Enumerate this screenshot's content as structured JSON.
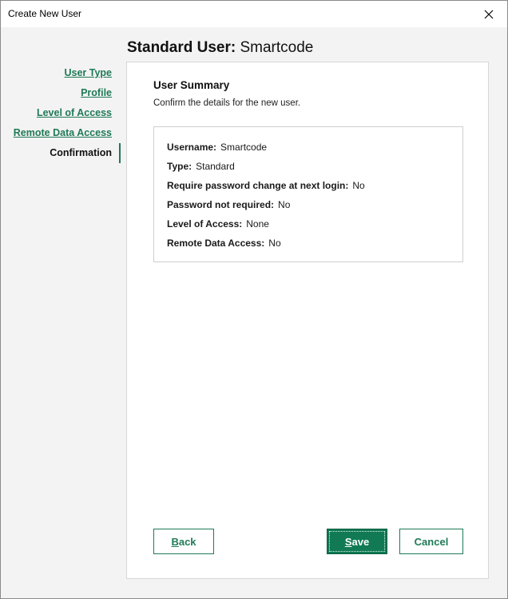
{
  "window": {
    "title": "Create New User"
  },
  "header": {
    "bold": "Standard User:",
    "name": "Smartcode"
  },
  "nav": {
    "items": [
      {
        "label": "User Type"
      },
      {
        "label": "Profile"
      },
      {
        "label": "Level of Access"
      },
      {
        "label": "Remote Data Access"
      },
      {
        "label": "Confirmation"
      }
    ]
  },
  "summary": {
    "heading": "User Summary",
    "description": "Confirm the details for the new user.",
    "rows": [
      {
        "key": "Username:",
        "value": "Smartcode"
      },
      {
        "key": "Type:",
        "value": "Standard"
      },
      {
        "key": "Require password change at next login:",
        "value": "No"
      },
      {
        "key": "Password not required:",
        "value": "No"
      },
      {
        "key": "Level of Access:",
        "value": "None"
      },
      {
        "key": "Remote Data Access:",
        "value": "No"
      }
    ]
  },
  "buttons": {
    "back_mnemonic": "B",
    "back_rest": "ack",
    "save_mnemonic": "S",
    "save_rest": "ave",
    "cancel": "Cancel"
  },
  "colors": {
    "accent": "#1f7a57",
    "save_bg": "#117a55"
  },
  "icons": {
    "close": "close-icon"
  }
}
